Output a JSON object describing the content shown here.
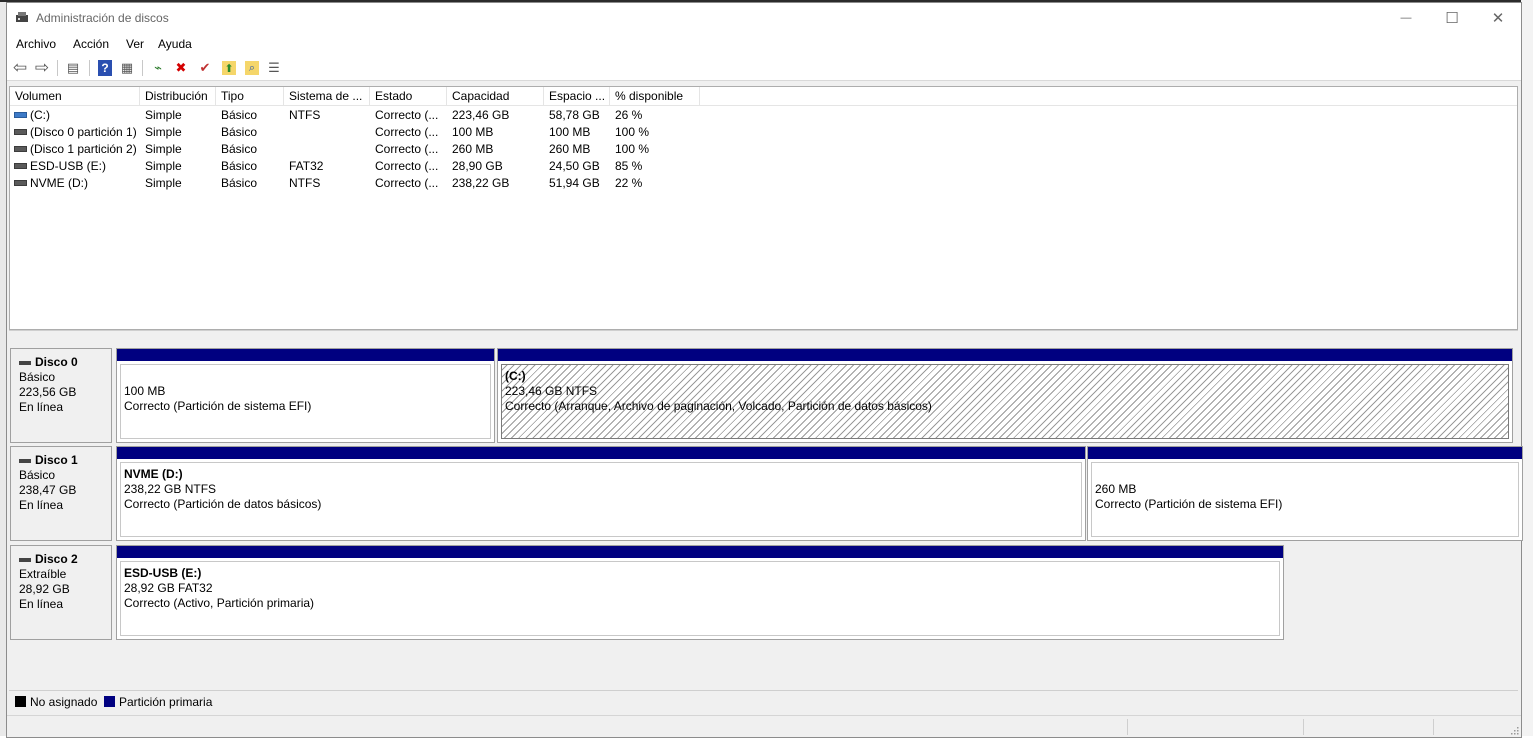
{
  "window": {
    "title": "Administración de discos",
    "minimize": "—",
    "maximize": "☐",
    "close": "✕"
  },
  "menu": [
    "Archivo",
    "Acción",
    "Ver",
    "Ayuda"
  ],
  "toolbar": [
    {
      "icon": "back-arrow-icon",
      "glyph": "⇦",
      "color": "#555555"
    },
    {
      "icon": "forward-arrow-icon",
      "glyph": "⇨",
      "color": "#555555"
    },
    {
      "icon": "console-tree-icon",
      "glyph": "▤",
      "color": "#555555"
    },
    {
      "icon": "help-icon",
      "glyph": "?",
      "color": "#ffffff"
    },
    {
      "icon": "properties-icon",
      "glyph": "▦",
      "color": "#555555"
    },
    {
      "icon": "connect-icon",
      "glyph": "⌁",
      "color": "#2a7a2a"
    },
    {
      "icon": "delete-icon",
      "glyph": "✖",
      "color": "#d40000"
    },
    {
      "icon": "check-icon",
      "glyph": "✔",
      "color": "#c03030"
    },
    {
      "icon": "up-folder-icon",
      "glyph": "⬆",
      "color": "#2a8a2a"
    },
    {
      "icon": "search-folder-icon",
      "glyph": "⌕",
      "color": "#2a5aaa"
    },
    {
      "icon": "list-view-icon",
      "glyph": "☰",
      "color": "#555555"
    }
  ],
  "volumes": {
    "headers": [
      "Volumen",
      "Distribución",
      "Tipo",
      "Sistema de ...",
      "Estado",
      "Capacidad",
      "Espacio ...",
      "% disponible"
    ],
    "rows": [
      {
        "volumen": "(C:)",
        "dist": "Simple",
        "tipo": "Básico",
        "fs": "NTFS",
        "estado": "Correcto (...",
        "cap": "223,46 GB",
        "esp": "58,78 GB",
        "pct": "26 %",
        "icon": "system-drive-icon"
      },
      {
        "volumen": "(Disco 0 partición 1)",
        "dist": "Simple",
        "tipo": "Básico",
        "fs": "",
        "estado": "Correcto (...",
        "cap": "100 MB",
        "esp": "100 MB",
        "pct": "100 %",
        "icon": "drive-icon"
      },
      {
        "volumen": "(Disco 1 partición 2)",
        "dist": "Simple",
        "tipo": "Básico",
        "fs": "",
        "estado": "Correcto (...",
        "cap": "260 MB",
        "esp": "260 MB",
        "pct": "100 %",
        "icon": "drive-icon"
      },
      {
        "volumen": "ESD-USB (E:)",
        "dist": "Simple",
        "tipo": "Básico",
        "fs": "FAT32",
        "estado": "Correcto (...",
        "cap": "28,90 GB",
        "esp": "24,50 GB",
        "pct": "85 %",
        "icon": "drive-icon"
      },
      {
        "volumen": "NVME (D:)",
        "dist": "Simple",
        "tipo": "Básico",
        "fs": "NTFS",
        "estado": "Correcto (...",
        "cap": "238,22 GB",
        "esp": "51,94 GB",
        "pct": "22 %",
        "icon": "drive-icon"
      }
    ]
  },
  "disks": [
    {
      "name": "Disco 0",
      "type": "Básico",
      "size": "223,56 GB",
      "status": "En línea",
      "partitions": [
        {
          "name": "",
          "size": "100 MB",
          "status": "Correcto (Partición de sistema EFI)",
          "selected": false
        },
        {
          "name": "(C:)",
          "size": "223,46 GB NTFS",
          "status": "Correcto (Arranque, Archivo de paginación, Volcado, Partición de datos básicos)",
          "selected": true
        }
      ]
    },
    {
      "name": "Disco 1",
      "type": "Básico",
      "size": "238,47 GB",
      "status": "En línea",
      "partitions": [
        {
          "name": "NVME  (D:)",
          "size": "238,22 GB NTFS",
          "status": "Correcto (Partición de datos básicos)",
          "selected": false
        },
        {
          "name": "",
          "size": "260 MB",
          "status": "Correcto (Partición de sistema EFI)",
          "selected": false
        }
      ]
    },
    {
      "name": "Disco 2",
      "type": "Extraíble",
      "size": "28,92 GB",
      "status": "En línea",
      "partitions": [
        {
          "name": "ESD-USB  (E:)",
          "size": "28,92 GB FAT32",
          "status": "Correcto (Activo, Partición primaria)",
          "selected": false
        }
      ]
    }
  ],
  "legend": [
    {
      "label": "No asignado",
      "color": "#000000"
    },
    {
      "label": "Partición primaria",
      "color": "#000080"
    }
  ],
  "colors": {
    "partition_cap": "#000080"
  }
}
